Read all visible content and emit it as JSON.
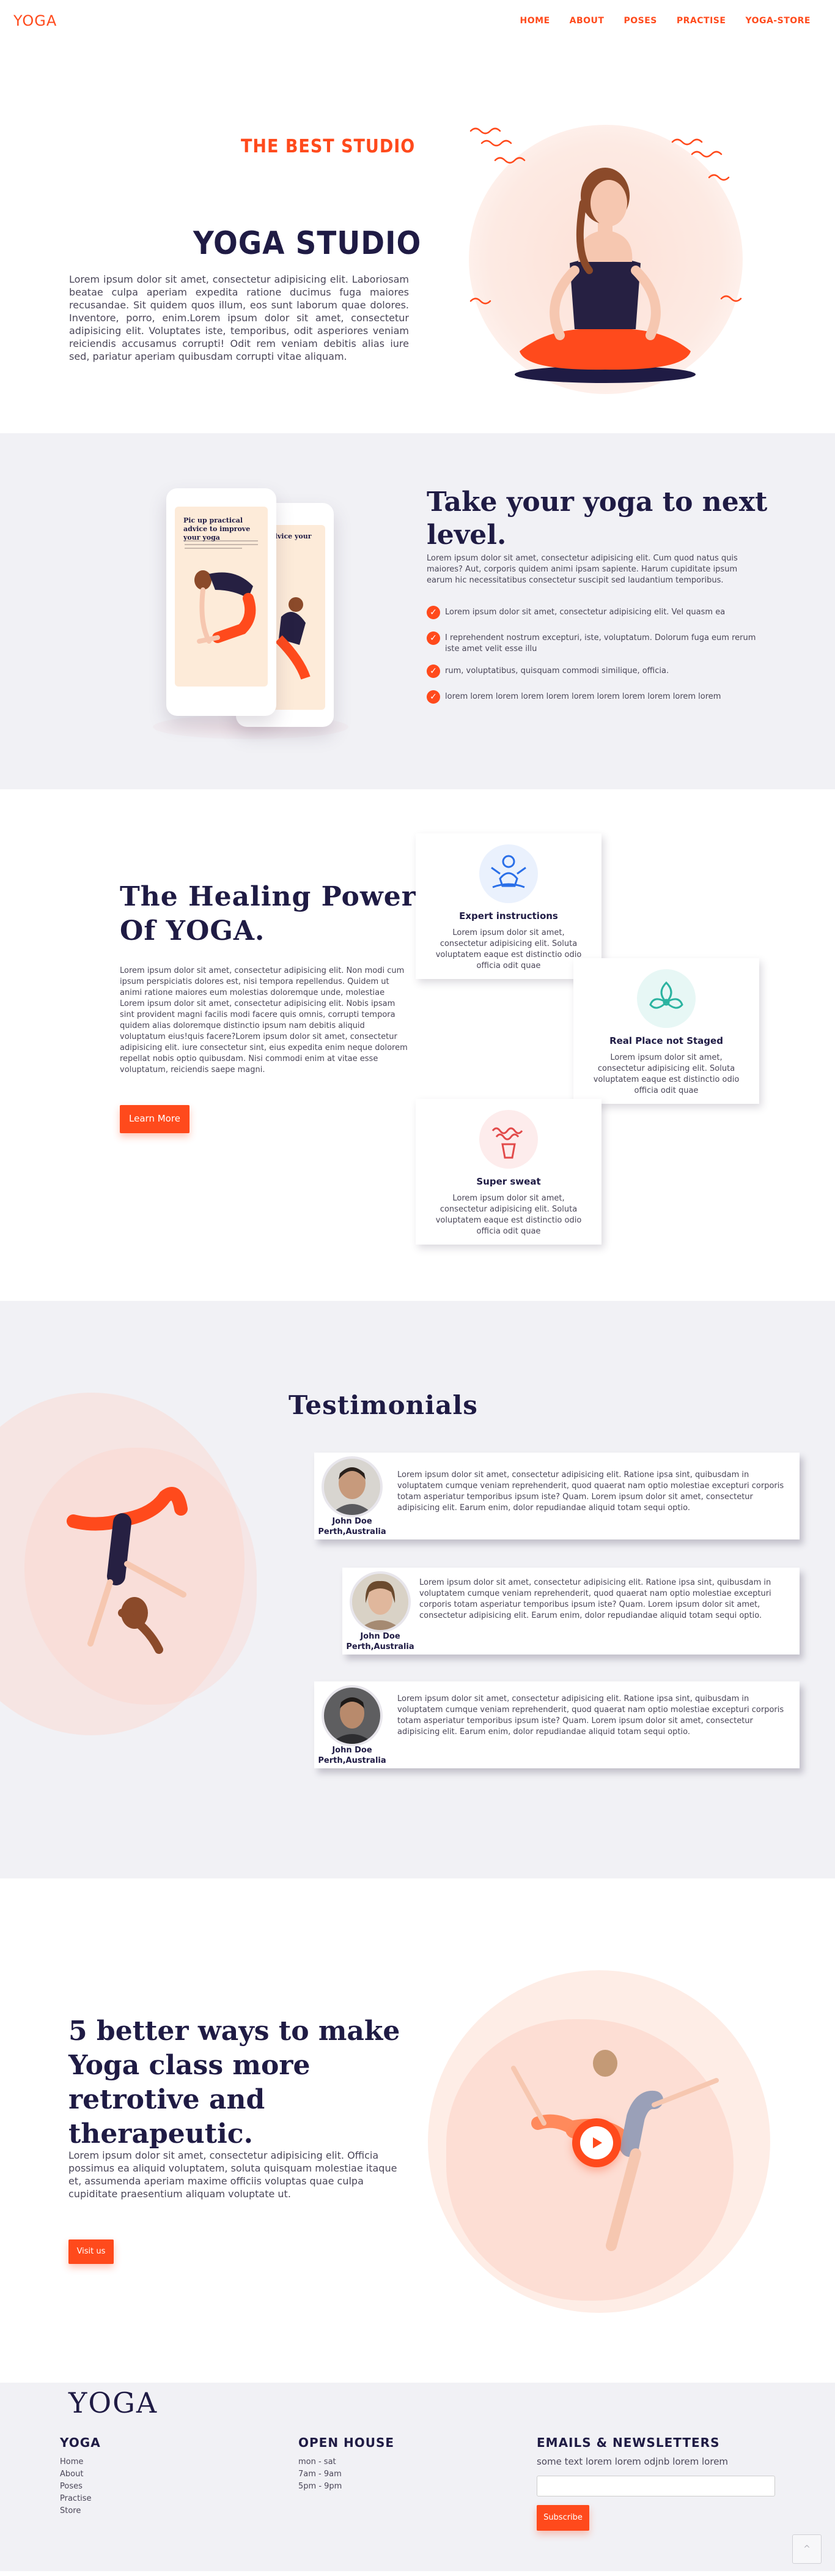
{
  "nav": {
    "brand": "YOGA",
    "items": [
      "HOME",
      "ABOUT",
      "POSES",
      "PRACTISE",
      "YOGA-STORE"
    ]
  },
  "hero": {
    "kicker": "THE BEST STUDIO",
    "title": "YOGA STUDIO",
    "copy": "Lorem ipsum dolor sit amet, consectetur adipisicing elit. Laboriosam beatae culpa aperiam expedita ratione ducimus fuga maiores recusandae. Sit quidem quos illum, eos sunt laborum quae dolores. Inventore, porro, enim.Lorem ipsum dolor sit amet, consectetur adipisicing elit. Voluptates iste, temporibus, odit asperiores veniam reiciendis accusamus corrupti! Odit rem veniam debitis alias iure sed, pariatur aperiam quibusdam corrupti vitae aliquam."
  },
  "section2": {
    "phone_title_front": "Pic up practical advice to improve your yoga",
    "phone_title_back": "tical advice your yoga",
    "title": "Take your yoga to next level.",
    "intro": "Lorem ipsum dolor sit amet, consectetur adipisicing elit. Cum quod natus quis maiores? Aut, corporis quidem animi ipsam sapiente. Harum cupiditate ipsum earum hic necessitatibus consectetur suscipit sed laudantium temporibus.",
    "checks": [
      "Lorem ipsum dolor sit amet, consectetur adipisicing elit. Vel quasm ea",
      "I reprehendent nostrum excepturi, iste, voluptatum. Dolorum fuga eum rerum iste amet velit esse illu",
      "rum, voluptatibus, quisquam commodi similique, officia.",
      "lorem lorem lorem lorem lorem lorem lorem lorem lorem lorem lorem"
    ]
  },
  "section3": {
    "title": "The Healing Power Of YOGA.",
    "copy": "Lorem ipsum dolor sit amet, consectetur adipisicing elit. Non modi cum ipsum perspiciatis dolores est, nisi tempora repellendus. Quidem ut animi ratione maiores eum molestias doloremque unde, molestiae Lorem ipsum dolor sit amet, consectetur adipisicing elit. Nobis ipsam sint provident magni facilis modi facere quis omnis, corrupti tempora quidem alias doloremque distinctio ipsum nam debitis aliquid voluptatum eius!quis facere?Lorem ipsum dolor sit amet, consectetur adipisicing elit. iure consectetur sint, eius expedita enim neque dolorem repellat nobis optio quibusdam. Nisi commodi enim at vitae esse voluptatum, reiciendis saepe magni.",
    "button": "Learn More",
    "cards": [
      {
        "title": "Expert instructions",
        "text": "Lorem ipsum dolor sit amet, consectetur adipisicing elit. Soluta voluptatem eaque est distinctio odio officia odit quae"
      },
      {
        "title": "Real Place not Staged",
        "text": "Lorem ipsum dolor sit amet, consectetur adipisicing elit. Soluta voluptatem eaque est distinctio odio officia odit quae"
      },
      {
        "title": "Super sweat",
        "text": "Lorem ipsum dolor sit amet, consectetur adipisicing elit. Soluta voluptatem eaque est distinctio odio officia odit quae"
      }
    ]
  },
  "testimonials": {
    "title": "Testimonials",
    "items": [
      {
        "name": "John Doe",
        "place": "Perth,Australia",
        "text": "Lorem ipsum dolor sit amet, consectetur adipisicing elit. Ratione ipsa sint, quibusdam in voluptatem cumque veniam reprehenderit, quod quaerat nam optio molestiae excepturi corporis totam asperiatur temporibus ipsum iste? Quam. Lorem ipsum dolor sit amet, consectetur adipisicing elit. Earum enim, dolor repudiandae aliquid totam sequi optio."
      },
      {
        "name": "John Doe",
        "place": "Perth,Australia",
        "text": "Lorem ipsum dolor sit amet, consectetur adipisicing elit. Ratione ipsa sint, quibusdam in voluptatem cumque veniam reprehenderit, quod quaerat nam optio molestiae excepturi corporis totam asperiatur temporibus ipsum iste? Quam. Lorem ipsum dolor sit amet, consectetur adipisicing elit. Earum enim, dolor repudiandae aliquid totam sequi optio."
      },
      {
        "name": "John Doe",
        "place": "Perth,Australia",
        "text": "Lorem ipsum dolor sit amet, consectetur adipisicing elit. Ratione ipsa sint, quibusdam in voluptatem cumque veniam reprehenderit, quod quaerat nam optio molestiae excepturi corporis totam asperiatur temporibus ipsum iste? Quam. Lorem ipsum dolor sit amet, consectetur adipisicing elit. Earum enim, dolor repudiandae aliquid totam sequi optio."
      }
    ]
  },
  "section5": {
    "title": "5 better ways to make Yoga class more retrotive and therapeutic.",
    "copy": "Lorem ipsum dolor sit amet, consectetur adipisicing elit. Officia possimus ea aliquid voluptatem, soluta quisquam molestiae itaque et, assumenda aperiam maxime officiis voluptas quae culpa cupiditate praesentium aliquam voluptate ut.",
    "button": "Visit us"
  },
  "footer": {
    "logo": "YOGA",
    "col1_title": "YOGA",
    "col1_links": [
      "Home",
      "About",
      "Poses",
      "Practise",
      "Store"
    ],
    "col2_title": "OPEN HOUSE",
    "col2_lines": [
      "mon - sat",
      "7am - 9am",
      "5pm - 9pm"
    ],
    "col3_title": "EMAILS & NEWSLETTERS",
    "col3_text": "some text lorem lorem odjnb lorem lorem",
    "email_placeholder": "",
    "button": "Subscribe"
  },
  "colors": {
    "accent": "#ff4a1c",
    "navy": "#1f1b44",
    "section_bg": "#f1f1f5"
  },
  "icons": [
    "check-icon",
    "instructor-icon",
    "lotus-icon",
    "sweat-icon",
    "play-icon",
    "chevron-up-icon"
  ]
}
